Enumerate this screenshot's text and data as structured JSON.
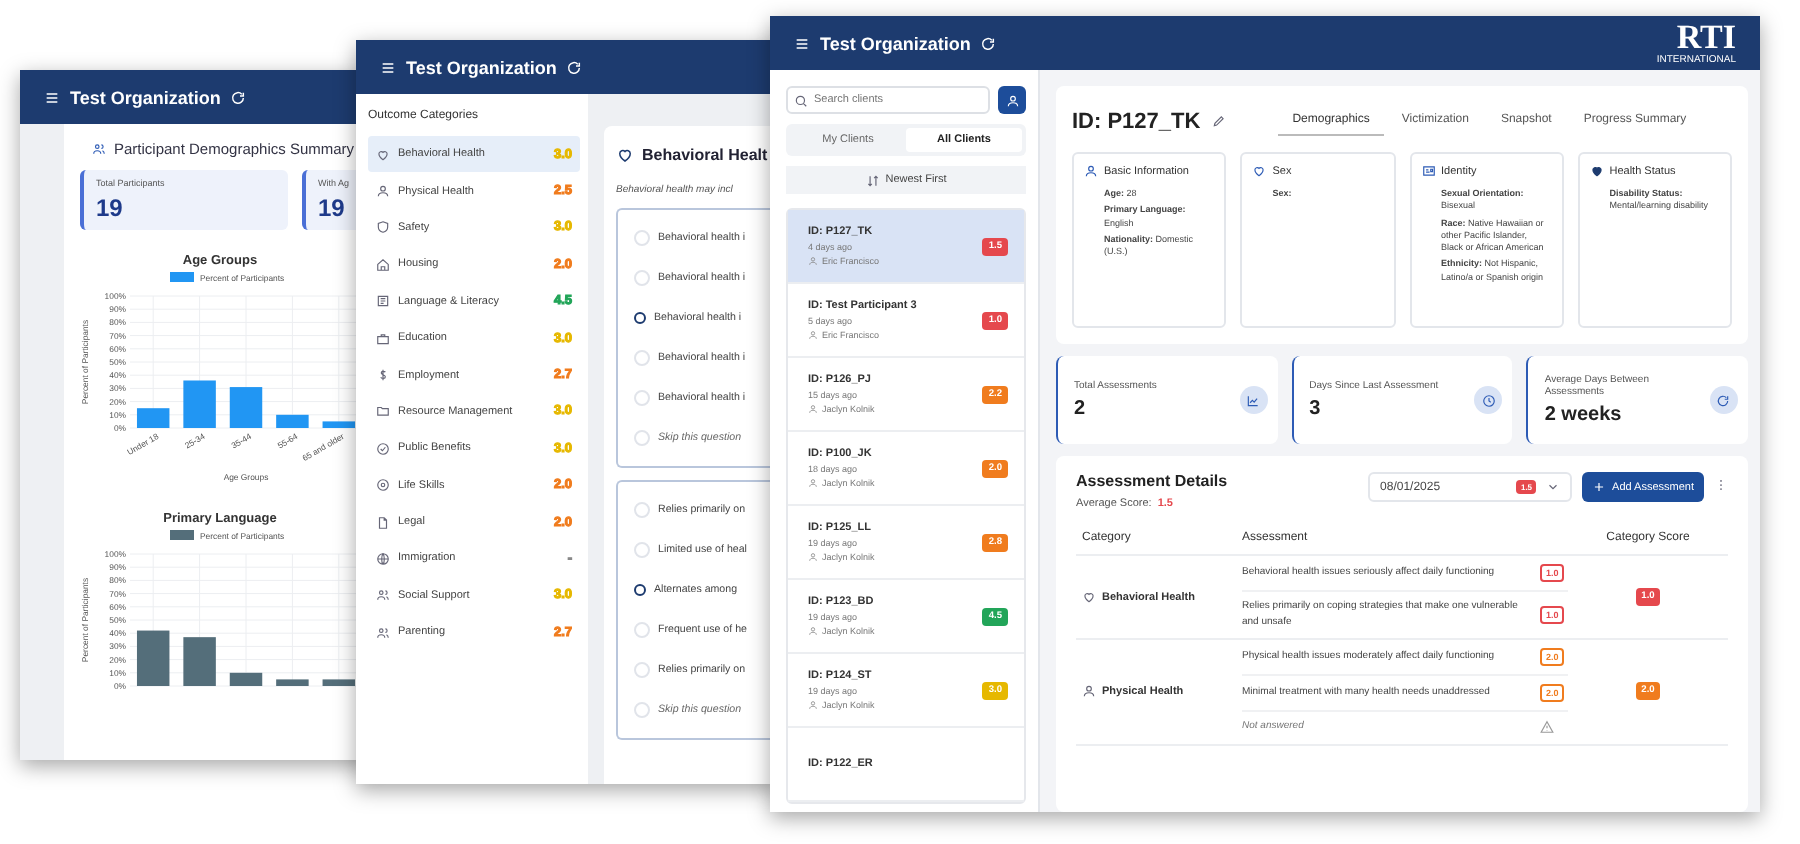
{
  "demographics_window": {
    "title": "Test Organization",
    "heading": "Participant Demographics Summary",
    "stats": [
      {
        "label": "Total Participants",
        "value": "19"
      },
      {
        "label": "With Ag",
        "value": "19"
      }
    ],
    "charts": [
      {
        "chart_data": {
          "type": "bar",
          "grid": true,
          "title": "Age Groups",
          "xlabel": "Age Groups",
          "ylabel": "Percent of Participants",
          "categories": [
            "Under 18",
            "25-34",
            "35-44",
            "55-64",
            "65 and older"
          ],
          "series": [
            {
              "name": "Percent of Participants",
              "color": "#2196f3",
              "values": [
                15,
                36,
                31,
                10,
                5
              ]
            }
          ],
          "ylim": [
            0,
            100
          ],
          "yticks": [
            {
              "value": 0,
              "label": "0%"
            },
            {
              "value": 10,
              "label": "10%"
            },
            {
              "value": 20,
              "label": "20%"
            },
            {
              "value": 30,
              "label": "30%"
            },
            {
              "value": 40,
              "label": "40%"
            },
            {
              "value": 50,
              "label": "50%"
            },
            {
              "value": 60,
              "label": "60%"
            },
            {
              "value": 70,
              "label": "70%"
            },
            {
              "value": 80,
              "label": "80%"
            },
            {
              "value": 90,
              "label": "90%"
            },
            {
              "value": 100,
              "label": "100%"
            }
          ]
        }
      },
      {
        "chart_data": {
          "type": "bar",
          "grid": true,
          "title": "Primary Language",
          "ylabel": "Percent of Participants",
          "series": [
            {
              "name": "Percent of Participants",
              "color": "#546e7a",
              "values": [
                42,
                37,
                10,
                5,
                5
              ]
            }
          ],
          "ylim": [
            0,
            100
          ],
          "yticks": [
            {
              "value": 0,
              "label": "0%"
            },
            {
              "value": 10,
              "label": "10%"
            },
            {
              "value": 20,
              "label": "20%"
            },
            {
              "value": 30,
              "label": "30%"
            },
            {
              "value": 40,
              "label": "40%"
            },
            {
              "value": 50,
              "label": "50%"
            },
            {
              "value": 60,
              "label": "60%"
            },
            {
              "value": 70,
              "label": "70%"
            },
            {
              "value": 80,
              "label": "80%"
            },
            {
              "value": 90,
              "label": "90%"
            },
            {
              "value": 100,
              "label": "100%"
            }
          ]
        }
      }
    ]
  },
  "assessment_window": {
    "title": "Test Organization",
    "sidebar_heading": "Outcome Categories",
    "categories": [
      {
        "label": "Behavioral Health",
        "score": "3.0",
        "color": "#e6b800",
        "selected": true
      },
      {
        "label": "Physical Health",
        "score": "2.5",
        "color": "#f07c1e",
        "selected": false
      },
      {
        "label": "Safety",
        "score": "3.0",
        "color": "#e6b800",
        "selected": false
      },
      {
        "label": "Housing",
        "score": "2.0",
        "color": "#f07c1e",
        "selected": false
      },
      {
        "label": "Language & Literacy",
        "score": "4.5",
        "color": "#22a559",
        "selected": false
      },
      {
        "label": "Education",
        "score": "3.0",
        "color": "#e6b800",
        "selected": false
      },
      {
        "label": "Employment",
        "score": "2.7",
        "color": "#f07c1e",
        "selected": false
      },
      {
        "label": "Resource Management",
        "score": "3.0",
        "color": "#e6b800",
        "selected": false
      },
      {
        "label": "Public Benefits",
        "score": "3.0",
        "color": "#e6b800",
        "selected": false
      },
      {
        "label": "Life Skills",
        "score": "2.0",
        "color": "#f07c1e",
        "selected": false
      },
      {
        "label": "Legal",
        "score": "2.0",
        "color": "#f07c1e",
        "selected": false
      },
      {
        "label": "Immigration",
        "score": "-",
        "color": "#888888",
        "selected": false
      },
      {
        "label": "Social Support",
        "score": "3.0",
        "color": "#e6b800",
        "selected": false
      },
      {
        "label": "Parenting",
        "score": "2.7",
        "color": "#f07c1e",
        "selected": false
      }
    ],
    "question_title": "Behavioral Healt",
    "description": "Behavioral health may incl",
    "question_groups": [
      {
        "options": [
          {
            "label": "Behavioral health i",
            "kind": "answer",
            "selected": false
          },
          {
            "label": "Behavioral health i",
            "kind": "answer",
            "selected": false
          },
          {
            "label": "Behavioral health i",
            "kind": "answer",
            "selected": true
          },
          {
            "label": "Behavioral health i",
            "kind": "answer",
            "selected": false
          },
          {
            "label": "Behavioral health i",
            "kind": "answer",
            "selected": false
          },
          {
            "label": "Skip this question",
            "kind": "skip",
            "selected": false
          }
        ]
      },
      {
        "options": [
          {
            "label": "Relies primarily on",
            "kind": "answer",
            "selected": false
          },
          {
            "label": "Limited use of heal",
            "kind": "answer",
            "selected": false
          },
          {
            "label": "Alternates among",
            "kind": "answer",
            "selected": true
          },
          {
            "label": "Frequent use of he",
            "kind": "answer",
            "selected": false
          },
          {
            "label": "Relies primarily on",
            "kind": "answer",
            "selected": false
          },
          {
            "label": "Skip this question",
            "kind": "skip",
            "selected": false
          }
        ]
      }
    ]
  },
  "client_window": {
    "title": "Test Organization",
    "logo": {
      "text": "RTI",
      "subtext": "INTERNATIONAL"
    },
    "search": {
      "placeholder": "Search clients"
    },
    "client_tabs": [
      {
        "label": "My Clients",
        "selected": false
      },
      {
        "label": "All Clients",
        "selected": true
      }
    ],
    "sort_label": "Newest First",
    "clients": [
      {
        "id": "ID: P127_TK",
        "ago": "4 days ago",
        "staff": "Eric Francisco",
        "score": "1.5",
        "color": "#e5484d",
        "selected": true
      },
      {
        "id": "ID: Test Participant 3",
        "ago": "5 days ago",
        "staff": "Eric Francisco",
        "score": "1.0",
        "color": "#e5484d",
        "selected": false
      },
      {
        "id": "ID: P126_PJ",
        "ago": "15 days ago",
        "staff": "Jaclyn Kolnik",
        "score": "2.2",
        "color": "#f07c1e",
        "selected": false
      },
      {
        "id": "ID: P100_JK",
        "ago": "18 days ago",
        "staff": "Jaclyn Kolnik",
        "score": "2.0",
        "color": "#f07c1e",
        "selected": false
      },
      {
        "id": "ID: P125_LL",
        "ago": "19 days ago",
        "staff": "Jaclyn Kolnik",
        "score": "2.8",
        "color": "#f07c1e",
        "selected": false
      },
      {
        "id": "ID: P123_BD",
        "ago": "19 days ago",
        "staff": "Jaclyn Kolnik",
        "score": "4.5",
        "color": "#22a559",
        "selected": false
      },
      {
        "id": "ID: P124_ST",
        "ago": "19 days ago",
        "staff": "Jaclyn Kolnik",
        "score": "3.0",
        "color": "#e6b800",
        "selected": false
      },
      {
        "id": "ID: P122_ER",
        "selected": false
      }
    ],
    "participant_id": "ID: P127_TK",
    "profile_tabs": [
      {
        "label": "Demographics",
        "selected": true
      },
      {
        "label": "Victimization",
        "selected": false
      },
      {
        "label": "Snapshot",
        "selected": false
      },
      {
        "label": "Progress Summary",
        "selected": false
      }
    ],
    "info_cards": [
      {
        "title": "Basic Information",
        "fields": [
          "**Age:** 28",
          "**Primary Language:** English",
          "**Nationality:** Domestic (U.S.)"
        ]
      },
      {
        "title": "Sex",
        "fields": [
          "**Sex:**"
        ]
      },
      {
        "title": "Identity",
        "fields": [
          "**Sexual Orientation:** Bisexual",
          "**Race:** Native Hawaiian or other Pacific Islander, Black or African American",
          "**Ethnicity:** Not Hispanic, Latino/a or Spanish origin"
        ]
      },
      {
        "title": "Health Status",
        "fields": [
          "**Disability Status:** Mental/learning disability"
        ]
      }
    ],
    "stats": [
      {
        "label": "Total Assessments",
        "value": "2"
      },
      {
        "label": "Days Since Last Assessment",
        "value": "3"
      },
      {
        "label": "Average Days Between Assessments",
        "value": "2 weeks"
      }
    ],
    "details": {
      "heading": "Assessment Details",
      "average_label": "Average Score:",
      "average_score": "1.5",
      "date": "08/01/2025",
      "date_score": "1.5",
      "add_button": "Add Assessment",
      "columns": [
        "Category",
        "Assessment",
        "Category Score"
      ],
      "rows": [
        {
          "category": "Behavioral Health",
          "score": "1.0",
          "color": "#e5484d",
          "items": [
            {
              "kind": "answered",
              "text": "Behavioral health issues seriously affect daily functioning",
              "score": "1.0"
            },
            {
              "kind": "answered",
              "text": "Relies primarily on coping strategies that make one vulnerable and unsafe",
              "score": "1.0"
            }
          ]
        },
        {
          "category": "Physical Health",
          "score": "2.0",
          "color": "#f07c1e",
          "items": [
            {
              "kind": "answered",
              "text": "Physical health issues moderately affect daily functioning",
              "score": "2.0"
            },
            {
              "kind": "answered",
              "text": "Minimal treatment with many health needs unaddressed",
              "score": "2.0"
            },
            {
              "kind": "unanswered",
              "text": "Not answered"
            }
          ]
        }
      ]
    }
  }
}
